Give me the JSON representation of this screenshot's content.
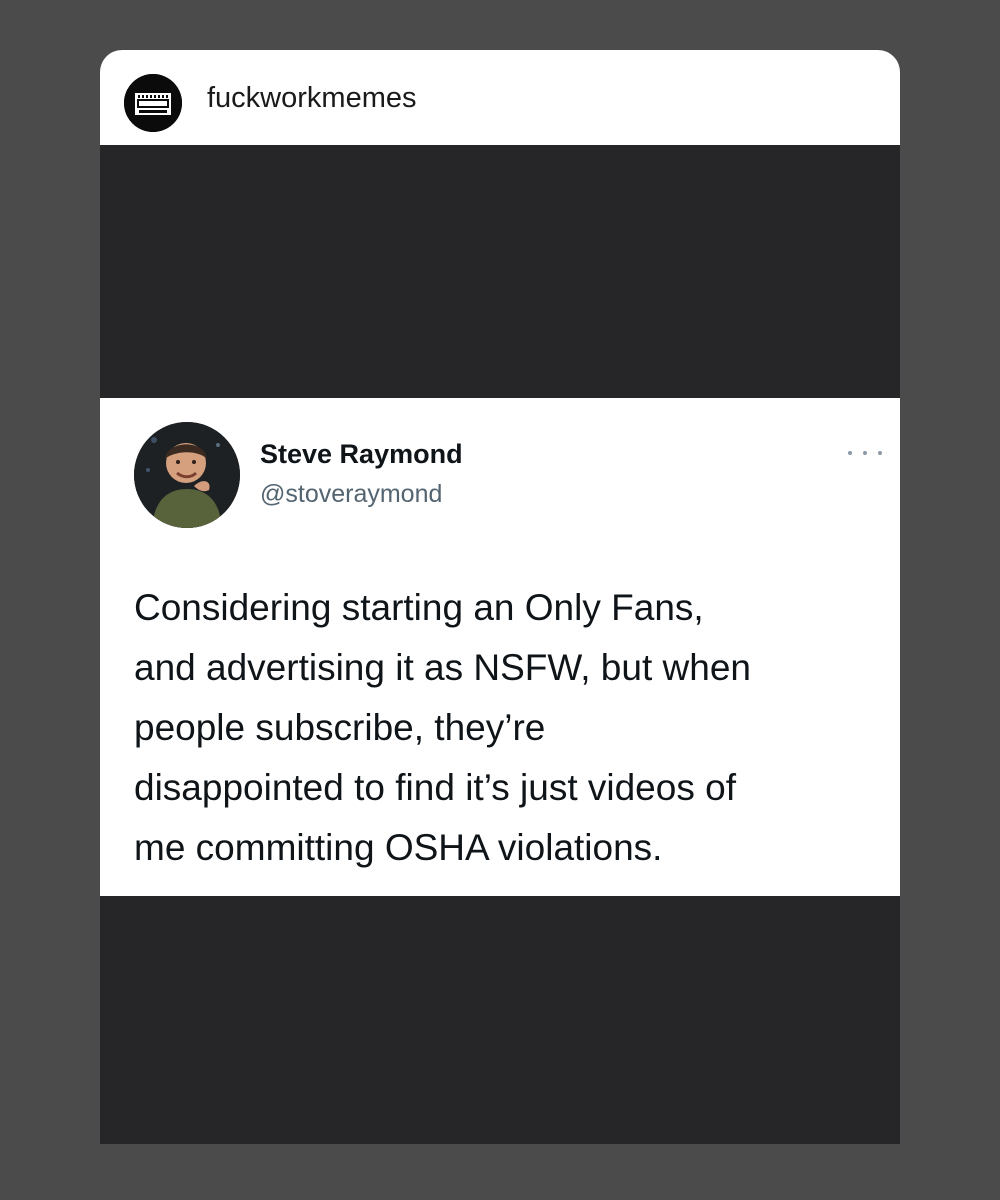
{
  "story": {
    "account": {
      "username": "fuckworkmemes",
      "avatar_icon": "parental-advisory-logo"
    }
  },
  "tweet": {
    "display_name": "Steve Raymond",
    "handle": "@stoveraymond",
    "text": "Considering starting an Only Fans,\nand advertising it as NSFW, but when\npeople subscribe, they’re\ndisappointed to find it’s just videos of\nme committing OSHA violations.",
    "more_icon": "ellipsis-icon"
  },
  "colors": {
    "page_background": "#4b4b4b",
    "media_background": "#262628",
    "tweet_background": "#ffffff",
    "handle_gray": "#536471"
  }
}
